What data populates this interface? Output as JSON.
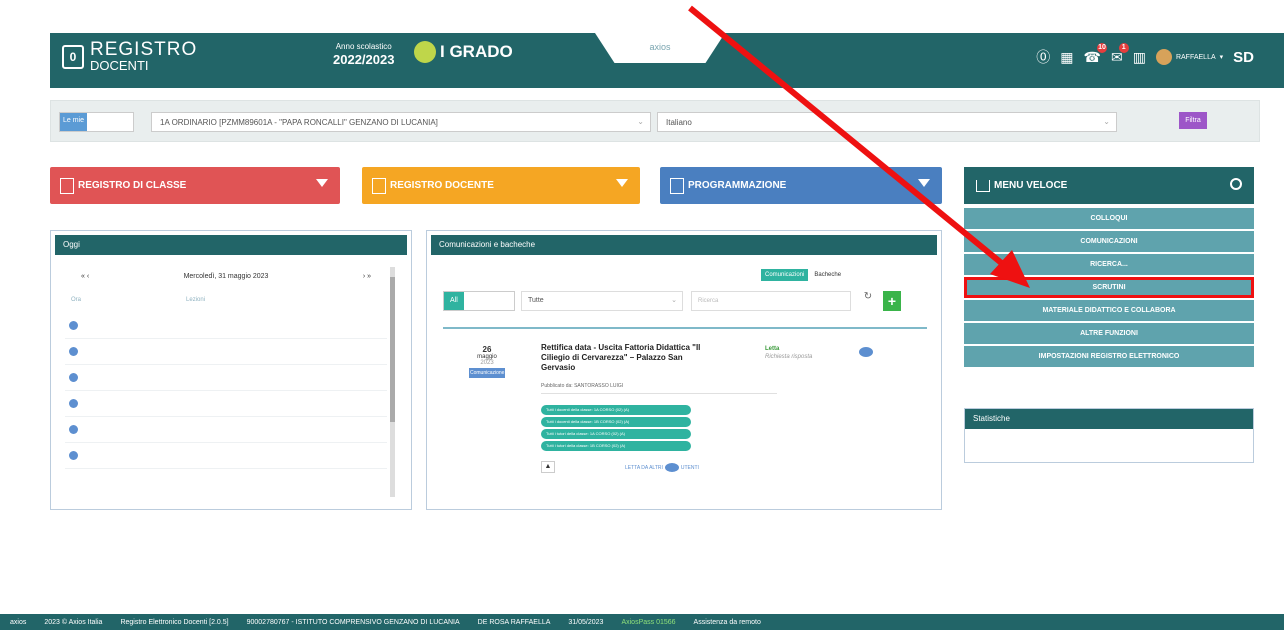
{
  "header": {
    "logo_top": "REGISTRO",
    "logo_bottom": "DOCENTI",
    "year_label": "Anno scolastico",
    "year_value": "2022/2023",
    "grade": "I GRADO",
    "tab_label": "axios",
    "user_name": "RAFFAELLA",
    "user_initials": "SD",
    "badge_notifications": "10",
    "badge_messages": "1"
  },
  "filter": {
    "tag": "Le mie",
    "class_select": "1A ORDINARIO [PZMM89601A - \"PAPA RONCALLI\" GENZANO DI LUCANIA]",
    "subject_select": "Italiano",
    "go_button": "Filtra"
  },
  "big_buttons": {
    "registro_classe": "REGISTRO DI CLASSE",
    "registro_docente": "REGISTRO DOCENTE",
    "programmazione": "PROGRAMMAZIONE"
  },
  "menu_veloce": {
    "title": "MENU VELOCE",
    "items": [
      "COLLOQUI",
      "COMUNICAZIONI",
      "RICERCA...",
      "SCRUTINI",
      "MATERIALE DIDATTICO E COLLABORA",
      "ALTRE FUNZIONI",
      "IMPOSTAZIONI REGISTRO ELETTRONICO"
    ]
  },
  "statistiche": {
    "title": "Statistiche"
  },
  "oggi": {
    "title": "Oggi",
    "prev": "« ‹",
    "next": "› »",
    "date": "Mercoledì, 31 maggio 2023",
    "col_ora": "Ora",
    "col_lezioni": "Lezioni"
  },
  "comunicazioni": {
    "title": "Comunicazioni e bacheche",
    "tab_comunicazioni": "Comunicazioni",
    "tab_bacheche": "Bacheche",
    "filter_all": "All",
    "filter_select": "Tutte",
    "search_placeholder": "Ricerca",
    "message": {
      "day": "26",
      "month": "maggio",
      "year": "2023",
      "tag": "Comunicazione",
      "title": "Rettifica data - Uscita Fattoria Didattica \"Il Ciliegio di Cervarezza\" – Palazzo San Gervasio",
      "by": "Pubblicato da: SANTORASSO LUIGI",
      "status": "Letta",
      "reply": "Richiesta risposta",
      "pills": [
        "Tutti i docenti della classe: 1A CORSO (02) (A)",
        "Tutti i docenti della classe: 1B CORSO (02) (A)",
        "Tutti i tutori della classe: 1A CORSO (02) (A)",
        "Tutti i tutori della classe: 1B CORSO (02) (A)"
      ],
      "read_by": "LETTA DA ALTRI",
      "read_count": "0",
      "read_suffix": "UTENTI"
    }
  },
  "footer": {
    "brand": "axios",
    "copyright": "2023 © Axios Italia",
    "version": "Registro Elettronico Docenti [2.0.5]",
    "school": "90002780767 - ISTITUTO COMPRENSIVO GENZANO DI LUCANIA",
    "user": "DE ROSA RAFFAELLA",
    "date": "31/05/2023",
    "pass": "AxiosPass 01566",
    "assistenza": "Assistenza da remoto"
  }
}
